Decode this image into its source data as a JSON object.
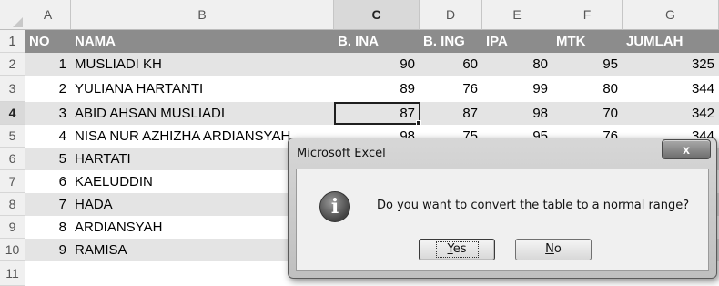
{
  "columns": [
    "A",
    "B",
    "C",
    "D",
    "E",
    "F",
    "G"
  ],
  "selected_column": "C",
  "selected_row": "4",
  "header_row": {
    "row": "1",
    "cells": [
      "NO",
      "NAMA",
      "B. INA",
      "B. ING",
      "IPA",
      "MTK",
      "JUMLAH"
    ]
  },
  "rows": [
    {
      "row": "2",
      "cells": [
        "1",
        "MUSLIADI KH",
        "90",
        "60",
        "80",
        "95",
        "325"
      ]
    },
    {
      "row": "3",
      "cells": [
        "2",
        "YULIANA HARTANTI",
        "89",
        "76",
        "99",
        "80",
        "344"
      ]
    },
    {
      "row": "4",
      "cells": [
        "3",
        "ABID AHSAN MUSLIADI",
        "87",
        "87",
        "98",
        "70",
        "342"
      ]
    },
    {
      "row": "5",
      "cells": [
        "4",
        "NISA NUR AZHIZHA ARDIANSYAH",
        "98",
        "75",
        "95",
        "76",
        "344"
      ]
    },
    {
      "row": "6",
      "cells": [
        "5",
        "HARTATI",
        "",
        "",
        "",
        "",
        ""
      ]
    },
    {
      "row": "7",
      "cells": [
        "6",
        "KAELUDDIN",
        "",
        "",
        "",
        "",
        ""
      ]
    },
    {
      "row": "8",
      "cells": [
        "7",
        "HADA",
        "",
        "",
        "",
        "",
        ""
      ]
    },
    {
      "row": "9",
      "cells": [
        "8",
        "ARDIANSYAH",
        "",
        "",
        "",
        "",
        ""
      ]
    },
    {
      "row": "10",
      "cells": [
        "9",
        "RAMISA",
        "",
        "",
        "",
        "",
        ""
      ]
    },
    {
      "row": "11",
      "cells": [
        "",
        "",
        "",
        "",
        "",
        "",
        ""
      ]
    }
  ],
  "dialog": {
    "title": "Microsoft Excel",
    "close_label": "x",
    "icon": "info-icon",
    "icon_glyph": "i",
    "message": "Do you want to convert the table to a normal range?",
    "yes_accel": "Y",
    "yes_rest": "es",
    "no_accel": "N",
    "no_rest": "o"
  },
  "colors": {
    "header_band": "#8c8c8c",
    "stripe": "#e4e4e4",
    "grid_header": "#f0f0f0"
  }
}
